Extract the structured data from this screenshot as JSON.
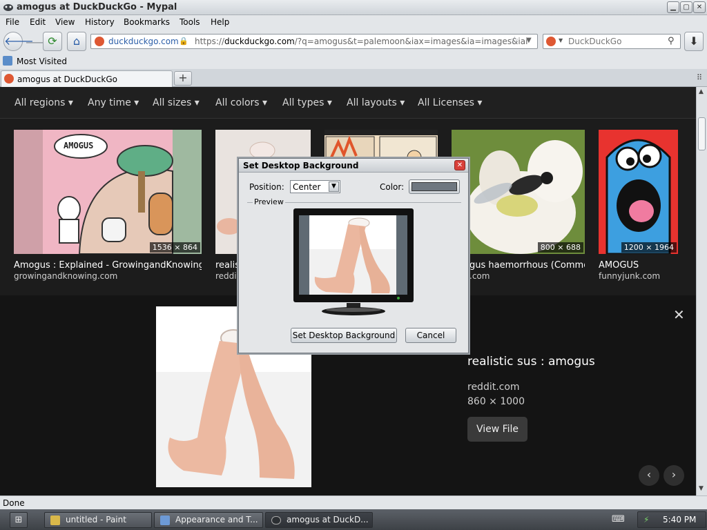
{
  "window": {
    "title": "amogus at DuckDuckGo - Mypal"
  },
  "menu": [
    "File",
    "Edit",
    "View",
    "History",
    "Bookmarks",
    "Tools",
    "Help"
  ],
  "nav": {
    "identity_domain": "duckduckgo.com",
    "url_prefix": "https://",
    "url_host": "duckduckgo.com",
    "url_rest": "/?q=amogus&t=palemoon&iax=images&ia=images&iai",
    "search_placeholder": "DuckDuckGo"
  },
  "bookmarks": {
    "most_visited": "Most Visited"
  },
  "tabs": [
    {
      "label": "amogus at DuckDuckGo"
    }
  ],
  "filters": [
    "All regions",
    "Any time",
    "All sizes",
    "All colors",
    "All types",
    "All layouts",
    "All Licenses"
  ],
  "results": [
    {
      "title": "Amogus : Explained - GrowingandKnowing",
      "source": "growingandknowing.com",
      "dims": "1536 × 864",
      "bubble": "AMOGUS"
    },
    {
      "title": "realist",
      "source": "reddit",
      "dims": ""
    },
    {
      "title": "",
      "source": "",
      "dims": ""
    },
    {
      "title": "gus haemorrhous (Commo...",
      "source": ".com",
      "dims": "800 × 688"
    },
    {
      "title": "AMOGUS",
      "source": "funnyjunk.com",
      "dims": "1200 × 1964"
    }
  ],
  "detail": {
    "title": "realistic sus : amogus",
    "source": "reddit.com",
    "dims": "860 × 1000",
    "view_file": "View File"
  },
  "dialog": {
    "title": "Set Desktop Background",
    "position_label": "Position:",
    "position_value": "Center",
    "color_label": "Color:",
    "color_value": "#6f7780",
    "preview_label": "Preview",
    "ok_button": "Set Desktop Background",
    "cancel_button": "Cancel"
  },
  "status": {
    "text": "Done"
  },
  "taskbar": {
    "tasks": [
      {
        "label": "untitled - Paint"
      },
      {
        "label": "Appearance and T..."
      },
      {
        "label": "amogus at DuckD..."
      }
    ],
    "clock": "5:40 PM"
  },
  "colors": {
    "accent": "#2b5ea8",
    "content_bg": "#1f1f1f",
    "dialog_close": "#d9403a"
  }
}
